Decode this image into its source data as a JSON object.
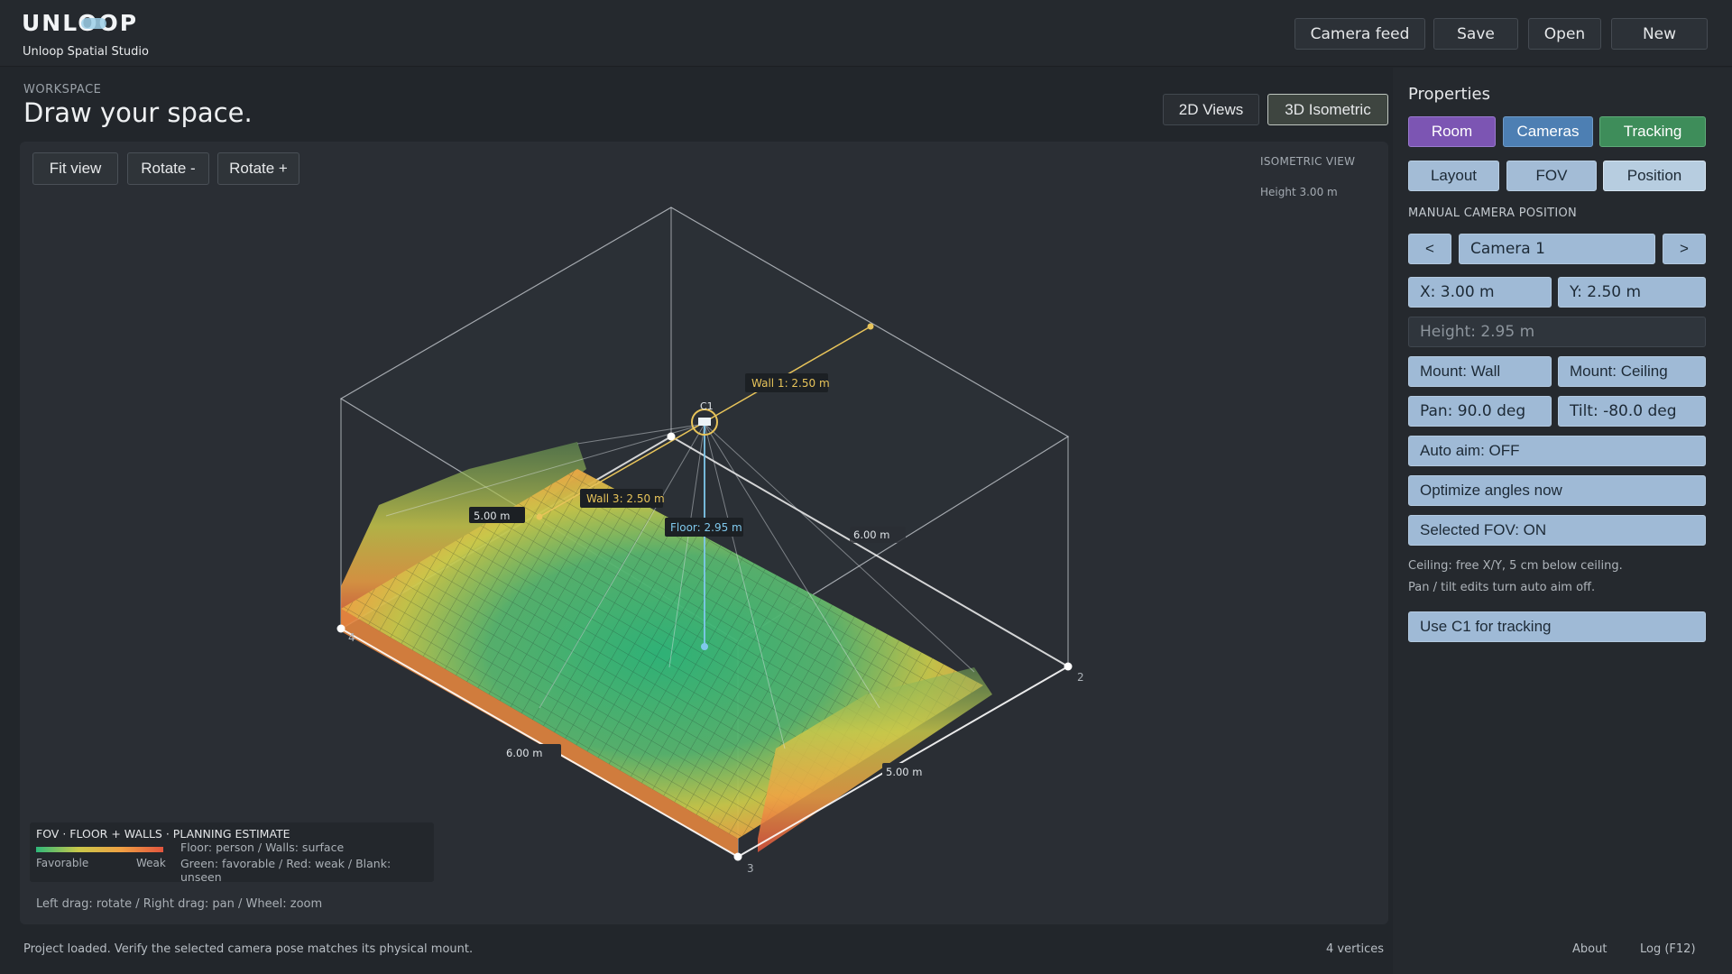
{
  "app": {
    "name": "Unloop Spatial Studio",
    "logo_text": "UNLOOP"
  },
  "header": {
    "buttons": [
      "Camera feed",
      "Save",
      "Open",
      "New"
    ]
  },
  "workspace": {
    "kicker": "WORKSPACE",
    "title": "Draw your space.",
    "view_2d": "2D Views",
    "view_3d": "3D Isometric",
    "tools": [
      "Fit view",
      "Rotate -",
      "Rotate +"
    ],
    "iso_label": "ISOMETRIC VIEW",
    "iso_height": "Height  3.00 m",
    "hint": "Left drag: rotate / Right drag: pan / Wheel: zoom"
  },
  "scene": {
    "camera_label": "C1",
    "labels": {
      "wall1": "Wall 1: 2.50 m",
      "wall3": "Wall 3: 2.50 m",
      "floor": "Floor: 2.95 m",
      "dim_left": "5.00 m",
      "dim_right_top": "6.00 m",
      "dim_bottom_left": "6.00 m",
      "dim_bottom_right": "5.00 m"
    },
    "vertex_labels": [
      "2",
      "3",
      "4"
    ],
    "colors": {
      "favorable": "#2fb87a",
      "mid": "#c9c84a",
      "warm": "#f0a144",
      "weak": "#e2553e",
      "wall1_line": "#e8c45a",
      "floor_line": "#7fc8ec"
    }
  },
  "legend": {
    "title": "FOV · FLOOR + WALLS · PLANNING ESTIMATE",
    "favorable": "Favorable",
    "weak": "Weak",
    "line1": "Floor: person / Walls: surface",
    "line2": "Green: favorable / Red: weak / Blank: unseen"
  },
  "status": {
    "message": "Project loaded. Verify the selected camera pose matches its physical mount.",
    "vertices": "4 vertices"
  },
  "properties": {
    "title": "Properties",
    "tabs": [
      "Room",
      "Cameras",
      "Tracking"
    ],
    "subtabs": [
      "Layout",
      "FOV",
      "Position"
    ],
    "section": "MANUAL CAMERA POSITION",
    "prev": "<",
    "next": ">",
    "camera_select": "Camera 1",
    "x": "X: 3.00 m",
    "y": "Y: 2.50 m",
    "height": "Height: 2.95 m",
    "mount_wall": "Mount: Wall",
    "mount_ceiling": "Mount: Ceiling",
    "pan": "Pan: 90.0 deg",
    "tilt": "Tilt: -80.0 deg",
    "auto_aim": "Auto aim: OFF",
    "optimize": "Optimize angles now",
    "selected_fov": "Selected FOV: ON",
    "note1": "Ceiling: free X/Y, 5 cm below ceiling.",
    "note2": "Pan / tilt edits turn auto aim off.",
    "use_tracking": "Use C1 for tracking"
  },
  "footer": {
    "about": "About",
    "log": "Log (F12)"
  }
}
